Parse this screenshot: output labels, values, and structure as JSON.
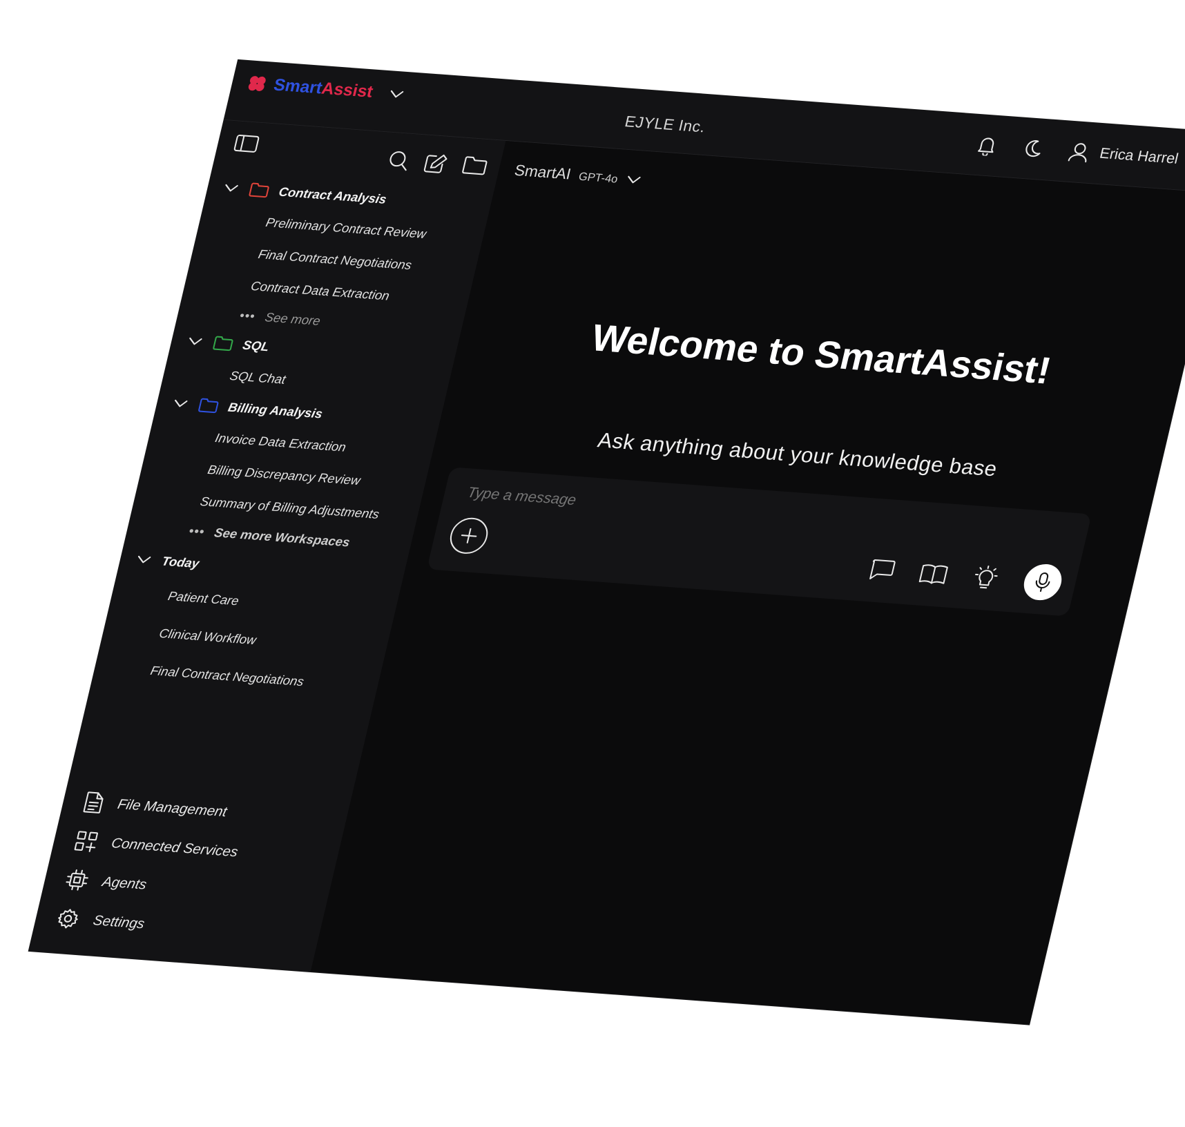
{
  "brand": {
    "part1": "Smart",
    "part2": "Assist",
    "logo_color": "#e0284b",
    "accent_blue": "#2f52e0"
  },
  "header": {
    "organization": "EJYLE Inc.",
    "user_name": "Erica Harrel"
  },
  "sidebar": {
    "groups": [
      {
        "label": "Contract Analysis",
        "folder_color": "#e0443a",
        "items": [
          "Preliminary Contract Review",
          "Final Contract Negotiations",
          "Contract Data Extraction"
        ],
        "more_label": "See more"
      },
      {
        "label": "SQL",
        "folder_color": "#33a84a",
        "items": [
          "SQL Chat"
        ]
      },
      {
        "label": "Billing Analysis",
        "folder_color": "#2f52e0",
        "items": [
          "Invoice Data Extraction",
          "Billing Discrepancy Review",
          "Summary of Billing Adjustments"
        ]
      }
    ],
    "see_more_workspaces": "See more Workspaces",
    "today": {
      "label": "Today",
      "items": [
        "Patient Care",
        "Clinical Workflow",
        "Final Contract Negotiations"
      ]
    },
    "bottom_nav": [
      {
        "label": "File Management",
        "icon": "file-icon"
      },
      {
        "label": "Connected Services",
        "icon": "grid-plus-icon"
      },
      {
        "label": "Agents",
        "icon": "chip-icon"
      },
      {
        "label": "Settings",
        "icon": "gear-icon"
      }
    ]
  },
  "main": {
    "model_name": "SmartAI",
    "model_version": "GPT-4o",
    "welcome_title": "Welcome to SmartAssist!",
    "subtitle": "Ask anything about your knowledge base",
    "composer": {
      "placeholder": "Type a message"
    }
  }
}
